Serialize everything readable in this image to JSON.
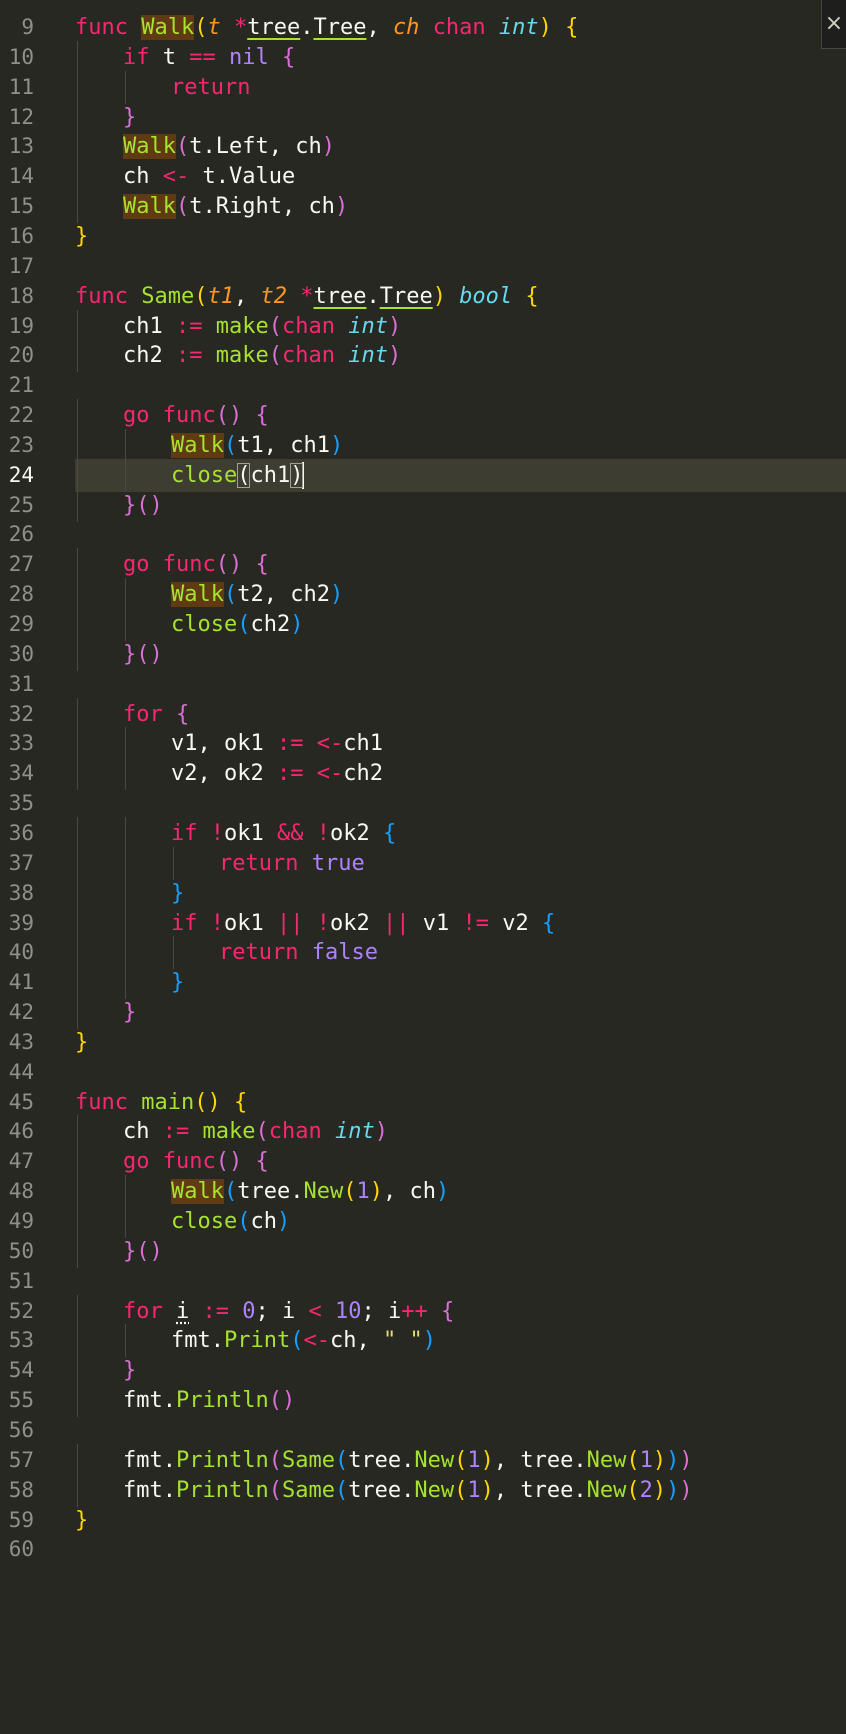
{
  "editor": {
    "close_icon": "×",
    "current_line": 24,
    "lines": [
      {
        "n": "9",
        "i": 0,
        "t": [
          [
            "kw",
            "func"
          ],
          [
            "p",
            " "
          ],
          [
            "hl",
            "Walk"
          ],
          [
            "b1",
            "("
          ],
          [
            "param",
            "t"
          ],
          [
            "p",
            " "
          ],
          [
            "op",
            "*"
          ],
          [
            "und",
            "tree"
          ],
          [
            "p",
            "."
          ],
          [
            "und",
            "Tree"
          ],
          [
            "p",
            ", "
          ],
          [
            "param",
            "ch"
          ],
          [
            "p",
            " "
          ],
          [
            "kw",
            "chan"
          ],
          [
            "p",
            " "
          ],
          [
            "ty",
            "int"
          ],
          [
            "b1",
            ")"
          ],
          [
            "p",
            " "
          ],
          [
            "b1",
            "{"
          ]
        ]
      },
      {
        "n": "10",
        "i": 1,
        "t": [
          [
            "kw",
            "if"
          ],
          [
            "p",
            " t "
          ],
          [
            "op",
            "=="
          ],
          [
            "p",
            " "
          ],
          [
            "cons",
            "nil"
          ],
          [
            "p",
            " "
          ],
          [
            "b2",
            "{"
          ]
        ]
      },
      {
        "n": "11",
        "i": 2,
        "t": [
          [
            "kw",
            "return"
          ]
        ]
      },
      {
        "n": "12",
        "i": 1,
        "t": [
          [
            "b2",
            "}"
          ]
        ]
      },
      {
        "n": "13",
        "i": 1,
        "t": [
          [
            "hl",
            "Walk"
          ],
          [
            "b2",
            "("
          ],
          [
            "p",
            "t.Left, ch"
          ],
          [
            "b2",
            ")"
          ]
        ]
      },
      {
        "n": "14",
        "i": 1,
        "t": [
          [
            "p",
            "ch "
          ],
          [
            "op",
            "<-"
          ],
          [
            "p",
            " t.Value"
          ]
        ]
      },
      {
        "n": "15",
        "i": 1,
        "t": [
          [
            "hl",
            "Walk"
          ],
          [
            "b2",
            "("
          ],
          [
            "p",
            "t.Right, ch"
          ],
          [
            "b2",
            ")"
          ]
        ]
      },
      {
        "n": "16",
        "i": 0,
        "t": [
          [
            "b1",
            "}"
          ]
        ]
      },
      {
        "n": "17",
        "i": 0,
        "t": []
      },
      {
        "n": "18",
        "i": 0,
        "t": [
          [
            "kw",
            "func"
          ],
          [
            "p",
            " "
          ],
          [
            "fn",
            "Same"
          ],
          [
            "b1",
            "("
          ],
          [
            "param",
            "t1"
          ],
          [
            "p",
            ", "
          ],
          [
            "param",
            "t2"
          ],
          [
            "p",
            " "
          ],
          [
            "op",
            "*"
          ],
          [
            "und",
            "tree"
          ],
          [
            "p",
            "."
          ],
          [
            "und",
            "Tree"
          ],
          [
            "b1",
            ")"
          ],
          [
            "p",
            " "
          ],
          [
            "ty",
            "bool"
          ],
          [
            "p",
            " "
          ],
          [
            "b1",
            "{"
          ]
        ]
      },
      {
        "n": "19",
        "i": 1,
        "t": [
          [
            "p",
            "ch1 "
          ],
          [
            "op",
            ":="
          ],
          [
            "p",
            " "
          ],
          [
            "fn",
            "make"
          ],
          [
            "b2",
            "("
          ],
          [
            "kw",
            "chan"
          ],
          [
            "p",
            " "
          ],
          [
            "ty",
            "int"
          ],
          [
            "b2",
            ")"
          ]
        ]
      },
      {
        "n": "20",
        "i": 1,
        "t": [
          [
            "p",
            "ch2 "
          ],
          [
            "op",
            ":="
          ],
          [
            "p",
            " "
          ],
          [
            "fn",
            "make"
          ],
          [
            "b2",
            "("
          ],
          [
            "kw",
            "chan"
          ],
          [
            "p",
            " "
          ],
          [
            "ty",
            "int"
          ],
          [
            "b2",
            ")"
          ]
        ]
      },
      {
        "n": "21",
        "i": 0,
        "t": []
      },
      {
        "n": "22",
        "i": 1,
        "t": [
          [
            "kw",
            "go"
          ],
          [
            "p",
            " "
          ],
          [
            "kw",
            "func"
          ],
          [
            "b2",
            "()"
          ],
          [
            "p",
            " "
          ],
          [
            "b2",
            "{"
          ]
        ]
      },
      {
        "n": "23",
        "i": 2,
        "t": [
          [
            "hl",
            "Walk"
          ],
          [
            "b3",
            "("
          ],
          [
            "p",
            "t1, ch1"
          ],
          [
            "b3",
            ")"
          ]
        ]
      },
      {
        "n": "24",
        "i": 2,
        "t": [
          [
            "fn",
            "close"
          ],
          [
            "box",
            "("
          ],
          [
            "p",
            "ch1"
          ],
          [
            "box",
            ")"
          ],
          [
            "cur",
            ""
          ]
        ]
      },
      {
        "n": "25",
        "i": 1,
        "t": [
          [
            "b2",
            "}()"
          ]
        ]
      },
      {
        "n": "26",
        "i": 0,
        "t": []
      },
      {
        "n": "27",
        "i": 1,
        "t": [
          [
            "kw",
            "go"
          ],
          [
            "p",
            " "
          ],
          [
            "kw",
            "func"
          ],
          [
            "b2",
            "()"
          ],
          [
            "p",
            " "
          ],
          [
            "b2",
            "{"
          ]
        ]
      },
      {
        "n": "28",
        "i": 2,
        "t": [
          [
            "hl",
            "Walk"
          ],
          [
            "b3",
            "("
          ],
          [
            "p",
            "t2, ch2"
          ],
          [
            "b3",
            ")"
          ]
        ]
      },
      {
        "n": "29",
        "i": 2,
        "t": [
          [
            "fn",
            "close"
          ],
          [
            "b3",
            "("
          ],
          [
            "p",
            "ch2"
          ],
          [
            "b3",
            ")"
          ]
        ]
      },
      {
        "n": "30",
        "i": 1,
        "t": [
          [
            "b2",
            "}()"
          ]
        ]
      },
      {
        "n": "31",
        "i": 0,
        "t": []
      },
      {
        "n": "32",
        "i": 1,
        "t": [
          [
            "kw",
            "for"
          ],
          [
            "p",
            " "
          ],
          [
            "b2",
            "{"
          ]
        ]
      },
      {
        "n": "33",
        "i": 2,
        "t": [
          [
            "p",
            "v1, ok1 "
          ],
          [
            "op",
            ":="
          ],
          [
            "p",
            " "
          ],
          [
            "op",
            "<-"
          ],
          [
            "p",
            "ch1"
          ]
        ]
      },
      {
        "n": "34",
        "i": 2,
        "t": [
          [
            "p",
            "v2, ok2 "
          ],
          [
            "op",
            ":="
          ],
          [
            "p",
            " "
          ],
          [
            "op",
            "<-"
          ],
          [
            "p",
            "ch2"
          ]
        ]
      },
      {
        "n": "35",
        "i": 0,
        "t": []
      },
      {
        "n": "36",
        "i": 2,
        "t": [
          [
            "kw",
            "if"
          ],
          [
            "p",
            " "
          ],
          [
            "op",
            "!"
          ],
          [
            "p",
            "ok1 "
          ],
          [
            "op",
            "&&"
          ],
          [
            "p",
            " "
          ],
          [
            "op",
            "!"
          ],
          [
            "p",
            "ok2 "
          ],
          [
            "b3",
            "{"
          ]
        ]
      },
      {
        "n": "37",
        "i": 3,
        "t": [
          [
            "kw",
            "return"
          ],
          [
            "p",
            " "
          ],
          [
            "cons",
            "true"
          ]
        ]
      },
      {
        "n": "38",
        "i": 2,
        "t": [
          [
            "b3",
            "}"
          ]
        ]
      },
      {
        "n": "39",
        "i": 2,
        "t": [
          [
            "kw",
            "if"
          ],
          [
            "p",
            " "
          ],
          [
            "op",
            "!"
          ],
          [
            "p",
            "ok1 "
          ],
          [
            "op",
            "||"
          ],
          [
            "p",
            " "
          ],
          [
            "op",
            "!"
          ],
          [
            "p",
            "ok2 "
          ],
          [
            "op",
            "||"
          ],
          [
            "p",
            " v1 "
          ],
          [
            "op",
            "!="
          ],
          [
            "p",
            " v2 "
          ],
          [
            "b3",
            "{"
          ]
        ]
      },
      {
        "n": "40",
        "i": 3,
        "t": [
          [
            "kw",
            "return"
          ],
          [
            "p",
            " "
          ],
          [
            "cons",
            "false"
          ]
        ]
      },
      {
        "n": "41",
        "i": 2,
        "t": [
          [
            "b3",
            "}"
          ]
        ]
      },
      {
        "n": "42",
        "i": 1,
        "t": [
          [
            "b2",
            "}"
          ]
        ]
      },
      {
        "n": "43",
        "i": 0,
        "t": [
          [
            "b1",
            "}"
          ]
        ]
      },
      {
        "n": "44",
        "i": 0,
        "t": []
      },
      {
        "n": "45",
        "i": 0,
        "t": [
          [
            "kw",
            "func"
          ],
          [
            "p",
            " "
          ],
          [
            "fn",
            "main"
          ],
          [
            "b1",
            "()"
          ],
          [
            "p",
            " "
          ],
          [
            "b1",
            "{"
          ]
        ]
      },
      {
        "n": "46",
        "i": 1,
        "t": [
          [
            "p",
            "ch "
          ],
          [
            "op",
            ":="
          ],
          [
            "p",
            " "
          ],
          [
            "fn",
            "make"
          ],
          [
            "b2",
            "("
          ],
          [
            "kw",
            "chan"
          ],
          [
            "p",
            " "
          ],
          [
            "ty",
            "int"
          ],
          [
            "b2",
            ")"
          ]
        ]
      },
      {
        "n": "47",
        "i": 1,
        "t": [
          [
            "kw",
            "go"
          ],
          [
            "p",
            " "
          ],
          [
            "kw",
            "func"
          ],
          [
            "b2",
            "()"
          ],
          [
            "p",
            " "
          ],
          [
            "b2",
            "{"
          ]
        ]
      },
      {
        "n": "48",
        "i": 2,
        "t": [
          [
            "hl",
            "Walk"
          ],
          [
            "b3",
            "("
          ],
          [
            "p",
            "tree."
          ],
          [
            "fn",
            "New"
          ],
          [
            "b1",
            "("
          ],
          [
            "num",
            "1"
          ],
          [
            "b1",
            ")"
          ],
          [
            "p",
            ", ch"
          ],
          [
            "b3",
            ")"
          ]
        ]
      },
      {
        "n": "49",
        "i": 2,
        "t": [
          [
            "fn",
            "close"
          ],
          [
            "b3",
            "("
          ],
          [
            "p",
            "ch"
          ],
          [
            "b3",
            ")"
          ]
        ]
      },
      {
        "n": "50",
        "i": 1,
        "t": [
          [
            "b2",
            "}()"
          ]
        ]
      },
      {
        "n": "51",
        "i": 0,
        "t": []
      },
      {
        "n": "52",
        "i": 1,
        "t": [
          [
            "kw",
            "for"
          ],
          [
            "p",
            " "
          ],
          [
            "dot",
            "i"
          ],
          [
            "p",
            " "
          ],
          [
            "op",
            ":="
          ],
          [
            "p",
            " "
          ],
          [
            "num",
            "0"
          ],
          [
            "p",
            "; i "
          ],
          [
            "op",
            "<"
          ],
          [
            "p",
            " "
          ],
          [
            "num",
            "10"
          ],
          [
            "p",
            "; i"
          ],
          [
            "op",
            "++"
          ],
          [
            "p",
            " "
          ],
          [
            "b2",
            "{"
          ]
        ]
      },
      {
        "n": "53",
        "i": 2,
        "t": [
          [
            "p",
            "fmt."
          ],
          [
            "fn",
            "Print"
          ],
          [
            "b3",
            "("
          ],
          [
            "op",
            "<-"
          ],
          [
            "p",
            "ch, "
          ],
          [
            "str",
            "\" \""
          ],
          [
            "b3",
            ")"
          ]
        ]
      },
      {
        "n": "54",
        "i": 1,
        "t": [
          [
            "b2",
            "}"
          ]
        ]
      },
      {
        "n": "55",
        "i": 1,
        "t": [
          [
            "p",
            "fmt."
          ],
          [
            "fn",
            "Println"
          ],
          [
            "b2",
            "()"
          ]
        ]
      },
      {
        "n": "56",
        "i": 0,
        "t": []
      },
      {
        "n": "57",
        "i": 1,
        "t": [
          [
            "p",
            "fmt."
          ],
          [
            "fn",
            "Println"
          ],
          [
            "b2",
            "("
          ],
          [
            "fn",
            "Same"
          ],
          [
            "b3",
            "("
          ],
          [
            "p",
            "tree."
          ],
          [
            "fn",
            "New"
          ],
          [
            "b1",
            "("
          ],
          [
            "num",
            "1"
          ],
          [
            "b1",
            ")"
          ],
          [
            "p",
            ", tree."
          ],
          [
            "fn",
            "New"
          ],
          [
            "b1",
            "("
          ],
          [
            "num",
            "1"
          ],
          [
            "b1",
            ")"
          ],
          [
            "b3",
            ")"
          ],
          [
            "b2",
            ")"
          ]
        ]
      },
      {
        "n": "58",
        "i": 1,
        "t": [
          [
            "p",
            "fmt."
          ],
          [
            "fn",
            "Println"
          ],
          [
            "b2",
            "("
          ],
          [
            "fn",
            "Same"
          ],
          [
            "b3",
            "("
          ],
          [
            "p",
            "tree."
          ],
          [
            "fn",
            "New"
          ],
          [
            "b1",
            "("
          ],
          [
            "num",
            "1"
          ],
          [
            "b1",
            ")"
          ],
          [
            "p",
            ", tree."
          ],
          [
            "fn",
            "New"
          ],
          [
            "b1",
            "("
          ],
          [
            "num",
            "2"
          ],
          [
            "b1",
            ")"
          ],
          [
            "b3",
            ")"
          ],
          [
            "b2",
            ")"
          ]
        ]
      },
      {
        "n": "59",
        "i": 0,
        "t": [
          [
            "b1",
            "}"
          ]
        ]
      },
      {
        "n": "60",
        "i": 0,
        "t": []
      }
    ]
  }
}
